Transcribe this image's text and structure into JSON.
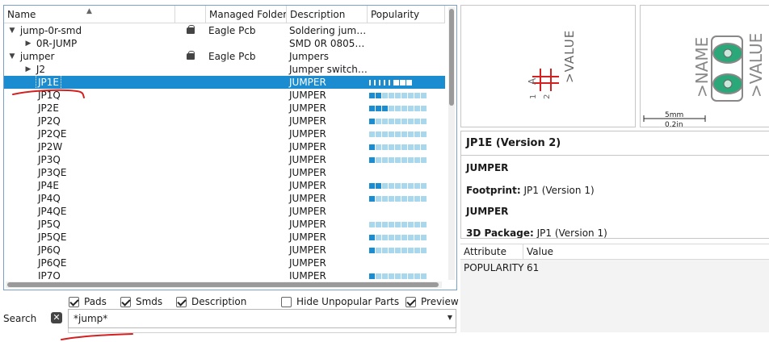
{
  "table": {
    "headers": {
      "name": "Name",
      "folder": "Managed Folder",
      "description": "Description",
      "popularity": "Popularity"
    },
    "rows": [
      {
        "name": "jump-0r-smd",
        "type": "library",
        "expand": "down",
        "lock": true,
        "folder": "Eagle Pcb",
        "description": "Soldering jump...",
        "bars": 0
      },
      {
        "name": "0R-JUMP",
        "type": "device",
        "expand": "right",
        "lock": false,
        "folder": "",
        "description": "SMD 0R 0805 J...",
        "bars": 0
      },
      {
        "name": "jumper",
        "type": "library",
        "expand": "down",
        "lock": true,
        "folder": "Eagle Pcb",
        "description": "Jumpers",
        "bars": 0
      },
      {
        "name": "J2",
        "type": "device",
        "expand": "right",
        "lock": false,
        "folder": "",
        "description": "Jumper switch ...",
        "bars": 0
      },
      {
        "name": "JP1E",
        "type": "item",
        "expand": "",
        "lock": false,
        "folder": "",
        "description": "JUMPER",
        "bars": 3,
        "selected": true
      },
      {
        "name": "JP1Q",
        "type": "item",
        "expand": "",
        "lock": false,
        "folder": "",
        "description": "JUMPER",
        "bars": 2
      },
      {
        "name": "JP2E",
        "type": "item",
        "expand": "",
        "lock": false,
        "folder": "",
        "description": "JUMPER",
        "bars": 3
      },
      {
        "name": "JP2Q",
        "type": "item",
        "expand": "",
        "lock": false,
        "folder": "",
        "description": "JUMPER",
        "bars": 1
      },
      {
        "name": "JP2QE",
        "type": "item",
        "expand": "",
        "lock": false,
        "folder": "",
        "description": "JUMPER",
        "bars": 0
      },
      {
        "name": "JP2W",
        "type": "item",
        "expand": "",
        "lock": false,
        "folder": "",
        "description": "JUMPER",
        "bars": 1
      },
      {
        "name": "JP3Q",
        "type": "item",
        "expand": "",
        "lock": false,
        "folder": "",
        "description": "JUMPER",
        "bars": 1
      },
      {
        "name": "JP3QE",
        "type": "item",
        "expand": "",
        "lock": false,
        "folder": "",
        "description": "JUMPER",
        "bars": -1
      },
      {
        "name": "JP4E",
        "type": "item",
        "expand": "",
        "lock": false,
        "folder": "",
        "description": "JUMPER",
        "bars": 2
      },
      {
        "name": "JP4Q",
        "type": "item",
        "expand": "",
        "lock": false,
        "folder": "",
        "description": "JUMPER",
        "bars": 1
      },
      {
        "name": "JP4QE",
        "type": "item",
        "expand": "",
        "lock": false,
        "folder": "",
        "description": "JUMPER",
        "bars": -1
      },
      {
        "name": "JP5Q",
        "type": "item",
        "expand": "",
        "lock": false,
        "folder": "",
        "description": "JUMPER",
        "bars": 0
      },
      {
        "name": "JP5QE",
        "type": "item",
        "expand": "",
        "lock": false,
        "folder": "",
        "description": "JUMPER",
        "bars": 1
      },
      {
        "name": "JP6Q",
        "type": "item",
        "expand": "",
        "lock": false,
        "folder": "",
        "description": "JUMPER",
        "bars": 1
      },
      {
        "name": "JP6QE",
        "type": "item",
        "expand": "",
        "lock": false,
        "folder": "",
        "description": "JUMPER",
        "bars": -1
      },
      {
        "name": "JP7Q",
        "type": "item",
        "expand": "",
        "lock": false,
        "folder": "",
        "description": "JUMPER",
        "bars": 1
      }
    ]
  },
  "filters": {
    "pads": {
      "label": "Pads",
      "checked": true
    },
    "smds": {
      "label": "Smds",
      "checked": true
    },
    "description": {
      "label": "Description",
      "checked": true
    },
    "hide_unpopular": {
      "label": "Hide Unpopular Parts",
      "checked": false
    },
    "preview": {
      "label": "Preview",
      "checked": true
    }
  },
  "search": {
    "label": "Search",
    "value": "*jump*"
  },
  "symbol_preview": {
    "pin1": "1",
    "pin2": "2",
    "part_label": "A",
    "value_label": ">VALUE"
  },
  "footprint_preview": {
    "name_label": ">NAME",
    "value_label": ">VALUE",
    "scale_mm": "5mm",
    "scale_in": "0.2in"
  },
  "details": {
    "title": "JP1E (Version 2)",
    "device_name": "JUMPER",
    "footprint_key": "Footprint:",
    "footprint_value": "JP1 (Version 1)",
    "footprint_desc": "JUMPER",
    "package3d_key": "3D Package:",
    "package3d_value": "JP1 (Version 1)"
  },
  "attributes": {
    "headers": {
      "attribute": "Attribute",
      "value": "Value"
    },
    "rows": [
      {
        "attribute": "POPULARITY",
        "value": "61"
      }
    ]
  },
  "colors": {
    "selection": "#1a8ccf",
    "bar_on": "#1a8ccf",
    "bar_off": "#a9d8ec",
    "pad_green": "#2aa87a",
    "symbol_red": "#d42020",
    "annotation_red": "#d42020"
  }
}
